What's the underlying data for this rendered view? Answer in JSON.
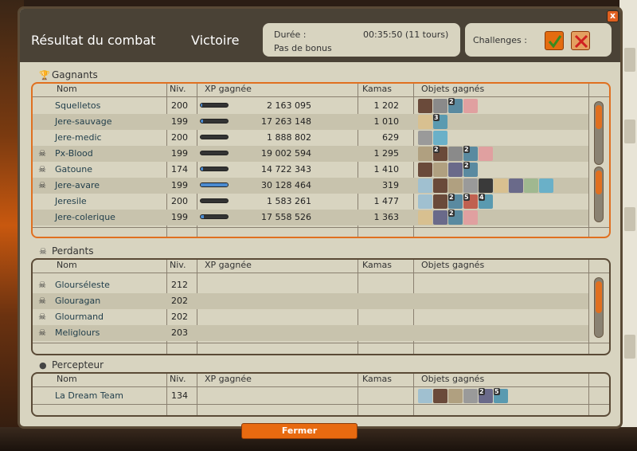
{
  "window": {
    "title": "Résultat du combat",
    "result": "Victoire",
    "duration_label": "Durée :",
    "duration_value": "00:35:50 (11 tours)",
    "bonus": "Pas de bonus",
    "challenges_label": "Challenges :",
    "close": "x"
  },
  "columns": {
    "name": "Nom",
    "level": "Niv.",
    "xp": "XP gagnée",
    "kamas": "Kamas",
    "items": "Objets gagnés"
  },
  "winners": {
    "title": "Gagnants",
    "rows": [
      {
        "name": "Squelletos",
        "skull": false,
        "level": "200",
        "xp": "2 163 095",
        "xp_fill": 0.05,
        "kamas": "1 202",
        "items": [
          {
            "c": "#6a4a3a",
            "q": ""
          },
          {
            "c": "#8a8a8a",
            "q": ""
          },
          {
            "c": "#5a8aa0",
            "q": "2"
          },
          {
            "c": "#e0a0a0",
            "q": ""
          }
        ]
      },
      {
        "name": "Jere-sauvage",
        "skull": false,
        "level": "199",
        "xp": "17 263 148",
        "xp_fill": 0.1,
        "kamas": "1 010",
        "items": [
          {
            "c": "#d8c090",
            "q": ""
          },
          {
            "c": "#5a9ab0",
            "q": "3"
          }
        ]
      },
      {
        "name": "Jere-medic",
        "skull": false,
        "level": "200",
        "xp": "1 888 802",
        "xp_fill": 0.0,
        "kamas": "629",
        "items": [
          {
            "c": "#9a9a9a",
            "q": ""
          },
          {
            "c": "#6ab0c8",
            "q": ""
          }
        ]
      },
      {
        "name": "Px-Blood",
        "skull": true,
        "level": "199",
        "xp": "19 002 594",
        "xp_fill": 0.0,
        "kamas": "1 295",
        "items": [
          {
            "c": "#b0a080",
            "q": ""
          },
          {
            "c": "#6a4a3a",
            "q": "2"
          },
          {
            "c": "#8a8a8a",
            "q": ""
          },
          {
            "c": "#5a8aa0",
            "q": "2"
          },
          {
            "c": "#e0a0a0",
            "q": ""
          }
        ]
      },
      {
        "name": "Gatoune",
        "skull": true,
        "level": "174",
        "xp": "14 722 343",
        "xp_fill": 0.08,
        "kamas": "1 410",
        "items": [
          {
            "c": "#6a4a3a",
            "q": ""
          },
          {
            "c": "#b0a080",
            "q": ""
          },
          {
            "c": "#6a6a8a",
            "q": ""
          },
          {
            "c": "#5a8aa0",
            "q": "2"
          }
        ]
      },
      {
        "name": "Jere-avare",
        "skull": true,
        "level": "199",
        "xp": "30 128 464",
        "xp_fill": 1.0,
        "kamas": "319",
        "items": [
          {
            "c": "#a0c0d0",
            "q": ""
          },
          {
            "c": "#6a4a3a",
            "q": ""
          },
          {
            "c": "#b0a080",
            "q": ""
          },
          {
            "c": "#9a9a9a",
            "q": ""
          },
          {
            "c": "#3a3a3a",
            "q": ""
          },
          {
            "c": "#d8c090",
            "q": ""
          },
          {
            "c": "#6a6a8a",
            "q": ""
          },
          {
            "c": "#a0b890",
            "q": ""
          },
          {
            "c": "#6ab0c8",
            "q": ""
          }
        ]
      },
      {
        "name": "Jeresile",
        "skull": false,
        "level": "200",
        "xp": "1 583 261",
        "xp_fill": 0.0,
        "kamas": "1 477",
        "items": [
          {
            "c": "#a0c0d0",
            "q": ""
          },
          {
            "c": "#6a4a3a",
            "q": ""
          },
          {
            "c": "#5a8aa0",
            "q": "2"
          },
          {
            "c": "#c06050",
            "q": "5"
          },
          {
            "c": "#5a9ab0",
            "q": "4"
          }
        ]
      },
      {
        "name": "Jere-colerique",
        "skull": false,
        "level": "199",
        "xp": "17 558 526",
        "xp_fill": 0.12,
        "kamas": "1 363",
        "items": [
          {
            "c": "#d8c090",
            "q": ""
          },
          {
            "c": "#6a6a8a",
            "q": ""
          },
          {
            "c": "#5a8aa0",
            "q": "2"
          },
          {
            "c": "#e0a0a0",
            "q": ""
          }
        ]
      }
    ]
  },
  "losers": {
    "title": "Perdants",
    "rows": [
      {
        "name": "Glourséleste",
        "level": "212"
      },
      {
        "name": "Glouragan",
        "level": "202"
      },
      {
        "name": "Glourmand",
        "level": "202"
      },
      {
        "name": "Meliglours",
        "level": "203"
      }
    ]
  },
  "collector": {
    "title": "Percepteur",
    "rows": [
      {
        "name": "La Dream Team",
        "level": "134",
        "items": [
          {
            "c": "#a0c0d0",
            "q": ""
          },
          {
            "c": "#6a4a3a",
            "q": ""
          },
          {
            "c": "#b0a080",
            "q": ""
          },
          {
            "c": "#9a9a9a",
            "q": ""
          },
          {
            "c": "#6a6a8a",
            "q": "2"
          },
          {
            "c": "#5a9ab0",
            "q": "5"
          }
        ]
      }
    ]
  },
  "footer": {
    "close_button": "Fermer"
  }
}
